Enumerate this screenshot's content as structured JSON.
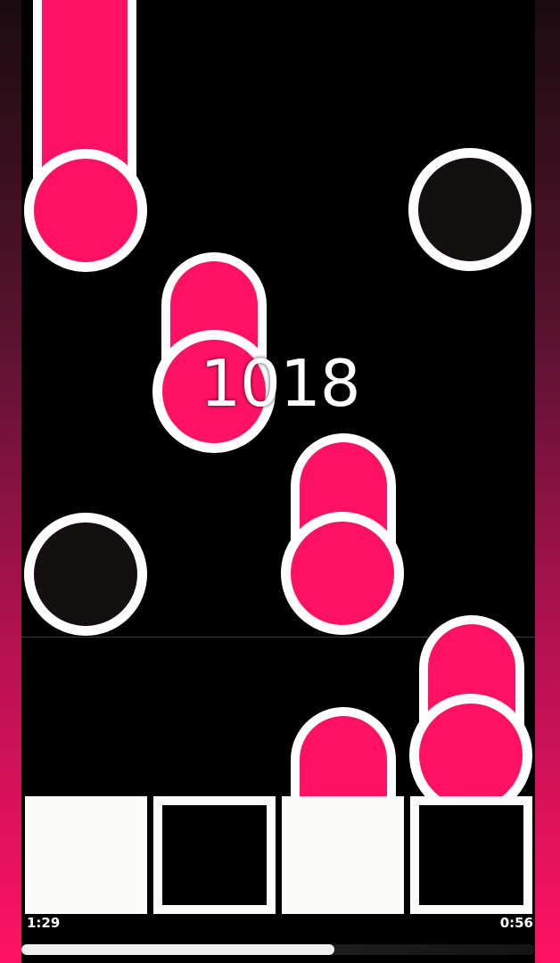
{
  "score": "1018",
  "time": {
    "elapsed": "1:29",
    "remaining": "0:56",
    "progress": 0.61
  },
  "pads": [
    {
      "lane": 1,
      "state": "pressed"
    },
    {
      "lane": 2,
      "state": "idle"
    },
    {
      "lane": 3,
      "state": "pressed"
    },
    {
      "lane": 4,
      "state": "idle"
    }
  ],
  "colors": {
    "note": "#ff1264",
    "outline": "#ffffff",
    "background": "#000000",
    "empty_note": "#141010"
  }
}
